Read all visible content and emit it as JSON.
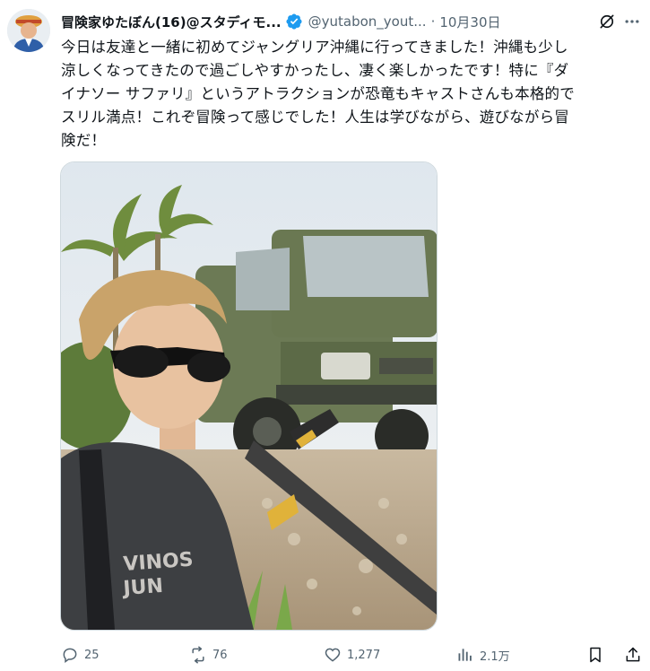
{
  "tweet": {
    "display_name": "冒険家ゆたぼん(16)@スタディモ...",
    "handle": "@yutabon_yout...",
    "date": "10月30日",
    "text": "今日は友達と一緒に初めてジャングリア沖縄に行ってきました！沖縄も少し\n涼しくなってきたので過ごしやすかったし、凄く楽しかったです！特に『ダ\nイナソー サファリ』というアトラクションが恐竜もキャストさんも本格的で\nスリル満点！これぞ冒険って感じでした！人生は学びながら、遊びながら冒\n険だ！",
    "media_shirt_text": "VINOS\nJUN",
    "stats": {
      "replies": "25",
      "reposts": "76",
      "likes": "1,277",
      "views": "2.1万"
    }
  },
  "colors": {
    "secondary_text": "#536471",
    "verified_blue": "#1d9bf0",
    "primary_text": "#0f1419"
  },
  "icons": {
    "verified": "verified-badge-icon",
    "grok": "grok-icon",
    "more": "more-icon",
    "reply": "reply-icon",
    "repost": "repost-icon",
    "like": "like-icon",
    "views": "views-icon",
    "bookmark": "bookmark-icon"
  }
}
